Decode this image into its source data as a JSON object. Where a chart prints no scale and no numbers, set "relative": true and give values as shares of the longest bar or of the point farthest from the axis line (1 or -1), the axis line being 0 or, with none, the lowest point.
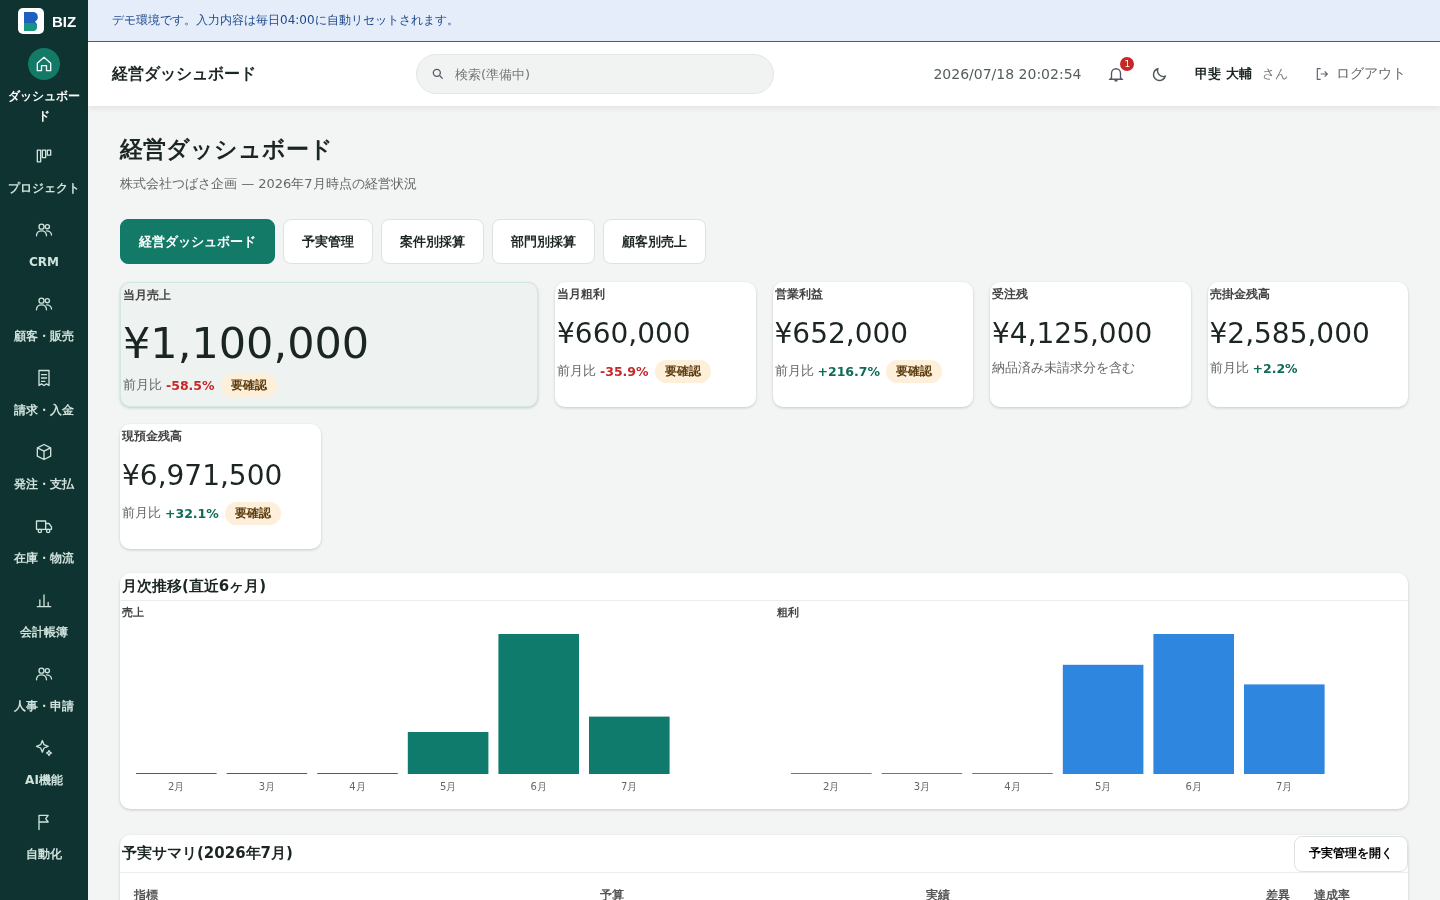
{
  "logo": {
    "text": "BIZ"
  },
  "banner": {
    "text": "デモ環境です。入力内容は毎日04:00に自動リセットされます。"
  },
  "sidebar": {
    "items": [
      {
        "label": "ダッシュボード",
        "selected": true
      },
      {
        "label": "プロジェクト",
        "selected": false
      },
      {
        "label": "CRM",
        "selected": false
      },
      {
        "label": "顧客・販売",
        "selected": false
      },
      {
        "label": "請求・入金",
        "selected": false
      },
      {
        "label": "発注・支払",
        "selected": false
      },
      {
        "label": "在庫・物流",
        "selected": false
      },
      {
        "label": "会計帳簿",
        "selected": false
      },
      {
        "label": "人事・申請",
        "selected": false
      },
      {
        "label": "AI機能",
        "selected": false
      },
      {
        "label": "自動化",
        "selected": false
      }
    ]
  },
  "header": {
    "title": "経営ダッシュボード",
    "search": {
      "placeholder": "検索(準備中)"
    },
    "datetime": "2026/07/18 20:02:54",
    "notifications": "1",
    "user": "甲斐 大輔",
    "honorific": "さん",
    "logout": "ログアウト"
  },
  "page": {
    "title": "経営ダッシュボード",
    "subtitle": "株式会社つばさ企画 — 2026年7月時点の経営状況"
  },
  "tabs": [
    {
      "label": "経営ダッシュボード",
      "selected": true
    },
    {
      "label": "予実管理",
      "selected": false
    },
    {
      "label": "案件別採算",
      "selected": false
    },
    {
      "label": "部門別採算",
      "selected": false
    },
    {
      "label": "顧客別売上",
      "selected": false
    }
  ],
  "kpis": [
    {
      "title": "当月売上",
      "value": "¥1,100,000",
      "featured": true,
      "change_label": "前月比",
      "change": "-58.5%",
      "color": "#c62828",
      "badge": "要確認"
    },
    {
      "title": "当月粗利",
      "value": "¥660,000",
      "featured": false,
      "change_label": "前月比",
      "change": "-35.9%",
      "color": "#c62828",
      "badge": "要確認"
    },
    {
      "title": "営業利益",
      "value": "¥652,000",
      "featured": false,
      "change_label": "前月比",
      "change": "+216.7%",
      "color": "#0e6b56",
      "badge": "要確認"
    },
    {
      "title": "受注残",
      "value": "¥4,125,000",
      "featured": false,
      "note": "納品済み未請求分を含む"
    },
    {
      "title": "売掛金残高",
      "value": "¥2,585,000",
      "featured": false,
      "change_label": "前月比",
      "change": "+2.2%",
      "color": "#0e6b56"
    },
    {
      "title": "現預金残高",
      "value": "¥6,971,500",
      "featured": false,
      "change_label": "前月比",
      "change": "+32.1%",
      "color": "#0e6b56",
      "badge": "要確認"
    }
  ],
  "monthly": {
    "title": "月次推移(直近6ヶ月)",
    "charts": [
      {
        "chart_data": {
          "type": "bar",
          "relative": true,
          "title": "売上",
          "categories": [
            "2月",
            "3月",
            "4月",
            "5月",
            "6月",
            "7月"
          ],
          "series": [
            {
              "color": "#0f7b6c",
              "values": [
                0,
                0,
                0,
                0.3,
                1,
                0.41
              ]
            }
          ]
        }
      },
      {
        "chart_data": {
          "type": "bar",
          "relative": true,
          "title": "粗利",
          "categories": [
            "2月",
            "3月",
            "4月",
            "5月",
            "6月",
            "7月"
          ],
          "series": [
            {
              "color": "#2e86de",
              "values": [
                0,
                0,
                0,
                0.78,
                1,
                0.64
              ]
            }
          ]
        }
      }
    ]
  },
  "summary": {
    "title": "予実サマリ(2026年7月)",
    "button": "予実管理を開く",
    "columns": [
      "指標",
      "予算",
      "実績",
      "差異",
      "達成率"
    ]
  }
}
